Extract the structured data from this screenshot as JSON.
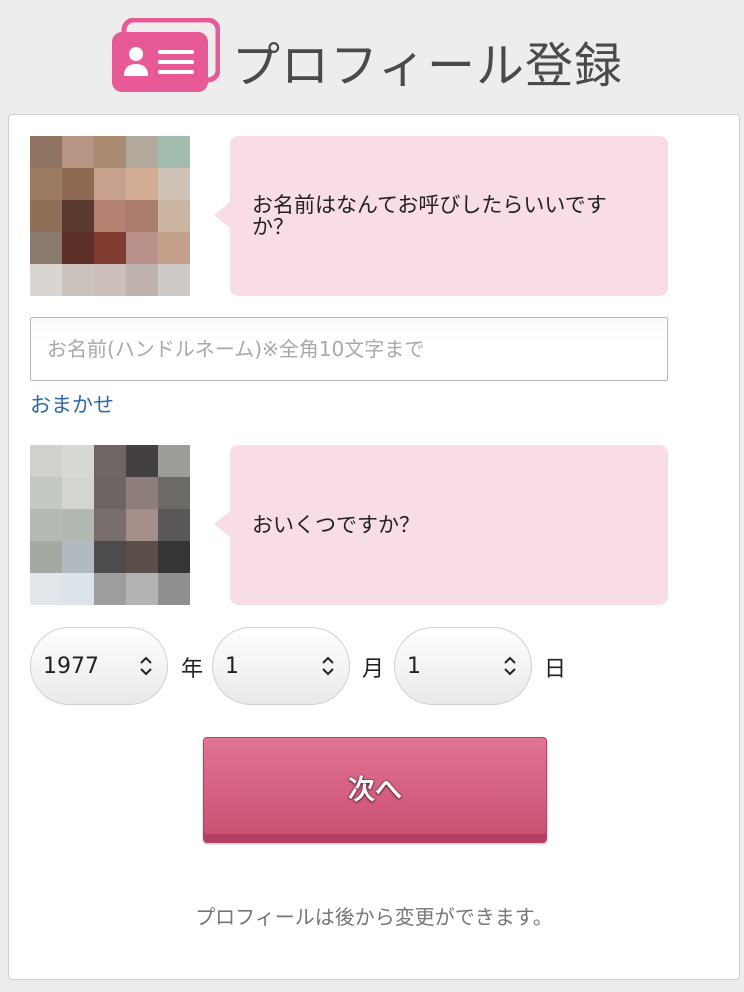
{
  "header": {
    "title": "プロフィール登録",
    "icon": "profile-card-icon",
    "icon_color": "#e85a96"
  },
  "chat": [
    {
      "question": "お名前はなんてお呼びしたらいいですか？"
    },
    {
      "question": "おいくつですか？"
    }
  ],
  "name_field": {
    "value": "",
    "placeholder": "お名前(ハンドルネーム)※全角10文字まで"
  },
  "random_name_link": "おまかせ",
  "birthdate": {
    "year": "1977",
    "year_unit": "年",
    "month": "1",
    "month_unit": "月",
    "day": "1",
    "day_unit": "日"
  },
  "next_button": "次へ",
  "footnote": "プロフィールは後から変更ができます。",
  "colors": {
    "accent": "#d35d80",
    "bubble": "#f8dde7",
    "link": "#2f6aa8"
  }
}
